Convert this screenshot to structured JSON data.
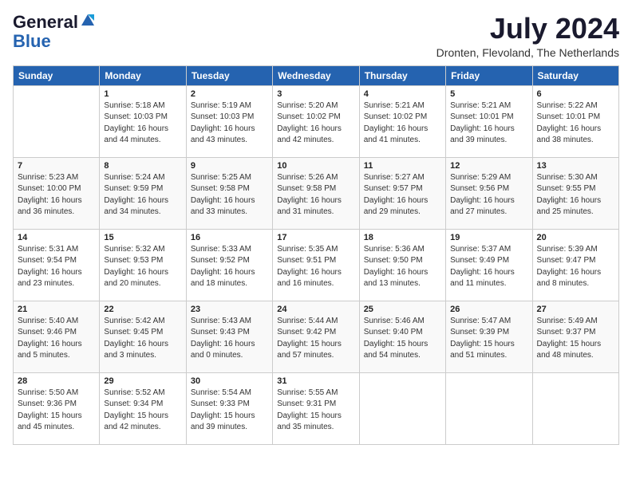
{
  "header": {
    "logo_general": "General",
    "logo_blue": "Blue",
    "month_title": "July 2024",
    "location": "Dronten, Flevoland, The Netherlands"
  },
  "weekdays": [
    "Sunday",
    "Monday",
    "Tuesday",
    "Wednesday",
    "Thursday",
    "Friday",
    "Saturday"
  ],
  "weeks": [
    [
      {
        "day": "",
        "info": ""
      },
      {
        "day": "1",
        "info": "Sunrise: 5:18 AM\nSunset: 10:03 PM\nDaylight: 16 hours\nand 44 minutes."
      },
      {
        "day": "2",
        "info": "Sunrise: 5:19 AM\nSunset: 10:03 PM\nDaylight: 16 hours\nand 43 minutes."
      },
      {
        "day": "3",
        "info": "Sunrise: 5:20 AM\nSunset: 10:02 PM\nDaylight: 16 hours\nand 42 minutes."
      },
      {
        "day": "4",
        "info": "Sunrise: 5:21 AM\nSunset: 10:02 PM\nDaylight: 16 hours\nand 41 minutes."
      },
      {
        "day": "5",
        "info": "Sunrise: 5:21 AM\nSunset: 10:01 PM\nDaylight: 16 hours\nand 39 minutes."
      },
      {
        "day": "6",
        "info": "Sunrise: 5:22 AM\nSunset: 10:01 PM\nDaylight: 16 hours\nand 38 minutes."
      }
    ],
    [
      {
        "day": "7",
        "info": "Sunrise: 5:23 AM\nSunset: 10:00 PM\nDaylight: 16 hours\nand 36 minutes."
      },
      {
        "day": "8",
        "info": "Sunrise: 5:24 AM\nSunset: 9:59 PM\nDaylight: 16 hours\nand 34 minutes."
      },
      {
        "day": "9",
        "info": "Sunrise: 5:25 AM\nSunset: 9:58 PM\nDaylight: 16 hours\nand 33 minutes."
      },
      {
        "day": "10",
        "info": "Sunrise: 5:26 AM\nSunset: 9:58 PM\nDaylight: 16 hours\nand 31 minutes."
      },
      {
        "day": "11",
        "info": "Sunrise: 5:27 AM\nSunset: 9:57 PM\nDaylight: 16 hours\nand 29 minutes."
      },
      {
        "day": "12",
        "info": "Sunrise: 5:29 AM\nSunset: 9:56 PM\nDaylight: 16 hours\nand 27 minutes."
      },
      {
        "day": "13",
        "info": "Sunrise: 5:30 AM\nSunset: 9:55 PM\nDaylight: 16 hours\nand 25 minutes."
      }
    ],
    [
      {
        "day": "14",
        "info": "Sunrise: 5:31 AM\nSunset: 9:54 PM\nDaylight: 16 hours\nand 23 minutes."
      },
      {
        "day": "15",
        "info": "Sunrise: 5:32 AM\nSunset: 9:53 PM\nDaylight: 16 hours\nand 20 minutes."
      },
      {
        "day": "16",
        "info": "Sunrise: 5:33 AM\nSunset: 9:52 PM\nDaylight: 16 hours\nand 18 minutes."
      },
      {
        "day": "17",
        "info": "Sunrise: 5:35 AM\nSunset: 9:51 PM\nDaylight: 16 hours\nand 16 minutes."
      },
      {
        "day": "18",
        "info": "Sunrise: 5:36 AM\nSunset: 9:50 PM\nDaylight: 16 hours\nand 13 minutes."
      },
      {
        "day": "19",
        "info": "Sunrise: 5:37 AM\nSunset: 9:49 PM\nDaylight: 16 hours\nand 11 minutes."
      },
      {
        "day": "20",
        "info": "Sunrise: 5:39 AM\nSunset: 9:47 PM\nDaylight: 16 hours\nand 8 minutes."
      }
    ],
    [
      {
        "day": "21",
        "info": "Sunrise: 5:40 AM\nSunset: 9:46 PM\nDaylight: 16 hours\nand 5 minutes."
      },
      {
        "day": "22",
        "info": "Sunrise: 5:42 AM\nSunset: 9:45 PM\nDaylight: 16 hours\nand 3 minutes."
      },
      {
        "day": "23",
        "info": "Sunrise: 5:43 AM\nSunset: 9:43 PM\nDaylight: 16 hours\nand 0 minutes."
      },
      {
        "day": "24",
        "info": "Sunrise: 5:44 AM\nSunset: 9:42 PM\nDaylight: 15 hours\nand 57 minutes."
      },
      {
        "day": "25",
        "info": "Sunrise: 5:46 AM\nSunset: 9:40 PM\nDaylight: 15 hours\nand 54 minutes."
      },
      {
        "day": "26",
        "info": "Sunrise: 5:47 AM\nSunset: 9:39 PM\nDaylight: 15 hours\nand 51 minutes."
      },
      {
        "day": "27",
        "info": "Sunrise: 5:49 AM\nSunset: 9:37 PM\nDaylight: 15 hours\nand 48 minutes."
      }
    ],
    [
      {
        "day": "28",
        "info": "Sunrise: 5:50 AM\nSunset: 9:36 PM\nDaylight: 15 hours\nand 45 minutes."
      },
      {
        "day": "29",
        "info": "Sunrise: 5:52 AM\nSunset: 9:34 PM\nDaylight: 15 hours\nand 42 minutes."
      },
      {
        "day": "30",
        "info": "Sunrise: 5:54 AM\nSunset: 9:33 PM\nDaylight: 15 hours\nand 39 minutes."
      },
      {
        "day": "31",
        "info": "Sunrise: 5:55 AM\nSunset: 9:31 PM\nDaylight: 15 hours\nand 35 minutes."
      },
      {
        "day": "",
        "info": ""
      },
      {
        "day": "",
        "info": ""
      },
      {
        "day": "",
        "info": ""
      }
    ]
  ]
}
